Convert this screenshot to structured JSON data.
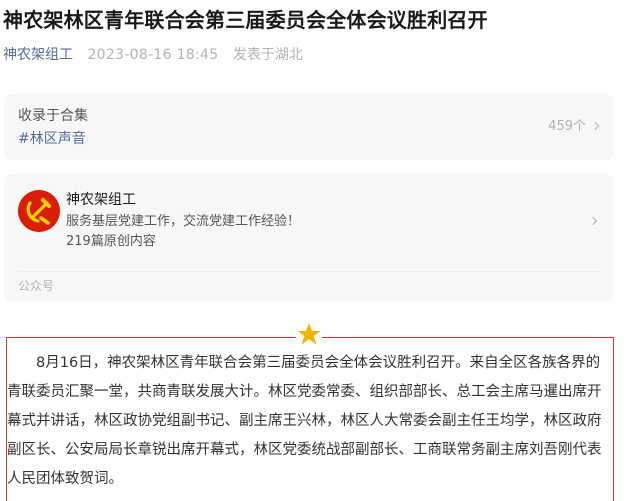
{
  "article": {
    "title": "神农架林区青年联合会第三届委员会全体会议胜利召开",
    "account": "神农架组工",
    "date": "2023-08-16 18:45",
    "location": "发表于湖北"
  },
  "collection": {
    "label": "收录于合集",
    "tag": "#林区声音",
    "count": "459个"
  },
  "profile": {
    "name": "神农架组工",
    "description": "服务基层党建工作，交流党建工作经验！",
    "stats": "219篇原创内容",
    "type": "公众号"
  },
  "body": {
    "paragraph": "8月16日，神农架林区青年联合会第三届委员会全体会议胜利召开。来自全区各族各界的青联委员汇聚一堂，共商青联发展大计。林区党委常委、组织部部长、总工会主席马暹出席开幕式并讲话，林区政协党组副书记、副主席王兴林，林区人大常委会副主任王均学，林区政府副区长、公安局局长章锐出席开幕式，林区党委统战部副部长、工商联常务副主席刘吾刚代表人民团体致贺词。"
  },
  "colors": {
    "link": "#576b95",
    "accent": "#e0382d",
    "star": "#f4b400",
    "avatar_bg": "#d81e06",
    "avatar_emblem": "#ffd200"
  },
  "icons": {
    "avatar": "party-emblem-icon",
    "chevron": "chevron-right-icon",
    "ornament": "star-icon"
  }
}
